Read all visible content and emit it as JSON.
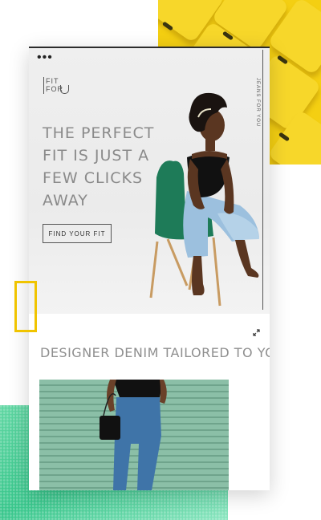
{
  "menu": {
    "dots_label": "•••"
  },
  "brand": {
    "line1": "FIT",
    "line2": "FOR"
  },
  "side_label": "JEANS FOR YOU",
  "hero": {
    "headline": "THE PERFECT FIT IS JUST A FEW CLICKS AWAY",
    "cta_label": "FIND YOUR FIT"
  },
  "section": {
    "title": "DESIGNER DENIM TAILORED TO YOU"
  },
  "colors": {
    "accent_yellow": "#f4cf12",
    "accent_green": "#37c68b",
    "text_gray": "#8a8a8a"
  },
  "icons": [
    "menu-dots-icon",
    "expand-icon"
  ]
}
